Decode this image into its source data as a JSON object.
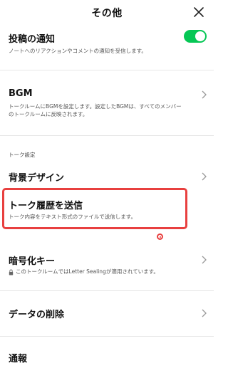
{
  "header": {
    "title": "その他",
    "close_icon": "close-icon"
  },
  "settings": {
    "post_notifications": {
      "label": "投稿の通知",
      "description": "ノートへのリアクションやコメントの通知を受信します。",
      "toggle_on": true,
      "toggle_color": "#06c755"
    },
    "bgm": {
      "label": "BGM",
      "description_line1": "トークルームにBGMを設定します。設定したBGMは、すべてのメンバー",
      "description_line2": "のトークルームに反映されます。"
    },
    "talk_section_header": "トーク設定",
    "background_design": {
      "label": "背景デザイン"
    },
    "send_chat_history": {
      "label": "トーク履歴を送信",
      "description": "トーク内容をテキスト形式のファイルで送信します。",
      "highlight_color": "#e8403f"
    },
    "encryption_keys": {
      "label": "暗号化キー",
      "description": "このトークルームではLetter Sealingが適用されています。",
      "lock_icon": "lock-icon"
    },
    "delete_data": {
      "label": "データの削除"
    },
    "report": {
      "label": "通報"
    }
  }
}
